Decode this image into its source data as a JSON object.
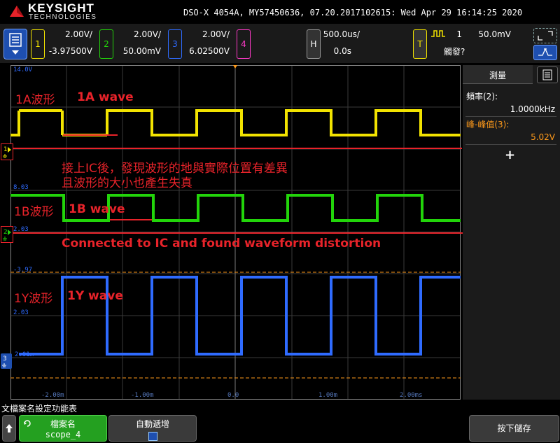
{
  "header": {
    "brand": "KEYSIGHT",
    "brand_sub": "TECHNOLOGIES",
    "model_line": "DSO-X 4054A, MY57450636, 07.20.2017102615: Wed Apr 29 16:14:25 2020"
  },
  "channels": [
    {
      "num": "1",
      "scale": "2.00V/",
      "offset": "-3.97500V",
      "color": "#f2e300"
    },
    {
      "num": "2",
      "scale": "2.00V/",
      "offset": "50.00mV",
      "color": "#22d40a"
    },
    {
      "num": "3",
      "scale": "2.00V/",
      "offset": "6.02500V",
      "color": "#2f6bff"
    },
    {
      "num": "4",
      "color": "#ff3ac8"
    }
  ],
  "horizontal": {
    "key": "H",
    "scale": "500.0us/",
    "delay": "0.0s"
  },
  "trigger": {
    "key": "T",
    "source": "1",
    "level": "50.0mV",
    "status": "觸發?"
  },
  "grid": {
    "left_labels": [
      "14.0V",
      "8.03",
      "2.03",
      "-3.97",
      "2.03",
      "2.01m"
    ],
    "bottom_labels": [
      "-2.00m",
      "-1.00m",
      "0.0",
      "1.00m",
      "2.00ms"
    ]
  },
  "measure_panel": {
    "title": "測量",
    "items": [
      {
        "label": "頻率(2):",
        "value": "1.0000kHz",
        "color": "#ffffff"
      },
      {
        "label": "峰-峰值(3):",
        "value": "5.02V",
        "color": "#ff9a1a"
      }
    ],
    "add_symbol": "+"
  },
  "annotations": {
    "a1": "1A波形",
    "a1_en": "1A wave",
    "note_cn_1": "接上IC後，發現波形的地與實際位置有差異",
    "note_cn_2": "且波形的大小也產生失真",
    "b1": "1B波形",
    "b1_en": "1B wave",
    "note_en": "Connected to IC and found waveform distortion",
    "y1": "1Y波形",
    "y1_en": "1Y wave"
  },
  "softkeys": {
    "menu_title": "文檔案名設定功能表",
    "filename_label": "檔案名",
    "filename_value": "scope_4",
    "auto_increment": "自動遞增",
    "press_save": "按下儲存"
  }
}
